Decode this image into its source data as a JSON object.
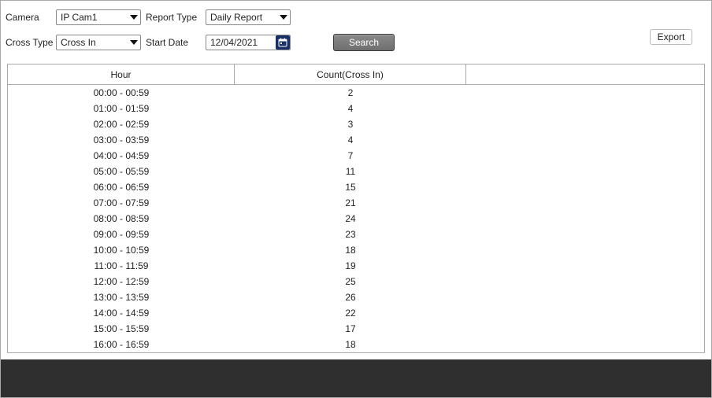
{
  "filters": {
    "camera_label": "Camera",
    "camera_value": "IP Cam1",
    "report_type_label": "Report Type",
    "report_type_value": "Daily Report",
    "cross_type_label": "Cross Type",
    "cross_type_value": "Cross In",
    "start_date_label": "Start Date",
    "start_date_value": "12/04/2021",
    "search_label": "Search",
    "export_label": "Export"
  },
  "table": {
    "header_hour": "Hour",
    "header_count": "Count(Cross In)",
    "rows": [
      {
        "hour": "00:00 - 00:59",
        "count": "2"
      },
      {
        "hour": "01:00 - 01:59",
        "count": "4"
      },
      {
        "hour": "02:00 - 02:59",
        "count": "3"
      },
      {
        "hour": "03:00 - 03:59",
        "count": "4"
      },
      {
        "hour": "04:00 - 04:59",
        "count": "7"
      },
      {
        "hour": "05:00 - 05:59",
        "count": "11"
      },
      {
        "hour": "06:00 - 06:59",
        "count": "15"
      },
      {
        "hour": "07:00 - 07:59",
        "count": "21"
      },
      {
        "hour": "08:00 - 08:59",
        "count": "24"
      },
      {
        "hour": "09:00 - 09:59",
        "count": "23"
      },
      {
        "hour": "10:00 - 10:59",
        "count": "18"
      },
      {
        "hour": "11:00 - 11:59",
        "count": "19"
      },
      {
        "hour": "12:00 - 12:59",
        "count": "25"
      },
      {
        "hour": "13:00 - 13:59",
        "count": "26"
      },
      {
        "hour": "14:00 - 14:59",
        "count": "22"
      },
      {
        "hour": "15:00 - 15:59",
        "count": "17"
      },
      {
        "hour": "16:00 - 16:59",
        "count": "18"
      }
    ]
  },
  "chart_data": {
    "type": "table",
    "title": "Daily Report — Count(Cross In) by Hour",
    "xlabel": "Hour",
    "ylabel": "Count(Cross In)",
    "categories": [
      "00:00 - 00:59",
      "01:00 - 01:59",
      "02:00 - 02:59",
      "03:00 - 03:59",
      "04:00 - 04:59",
      "05:00 - 05:59",
      "06:00 - 06:59",
      "07:00 - 07:59",
      "08:00 - 08:59",
      "09:00 - 09:59",
      "10:00 - 10:59",
      "11:00 - 11:59",
      "12:00 - 12:59",
      "13:00 - 13:59",
      "14:00 - 14:59",
      "15:00 - 15:59",
      "16:00 - 16:59"
    ],
    "values": [
      2,
      4,
      3,
      4,
      7,
      11,
      15,
      21,
      24,
      23,
      18,
      19,
      25,
      26,
      22,
      17,
      18
    ]
  }
}
